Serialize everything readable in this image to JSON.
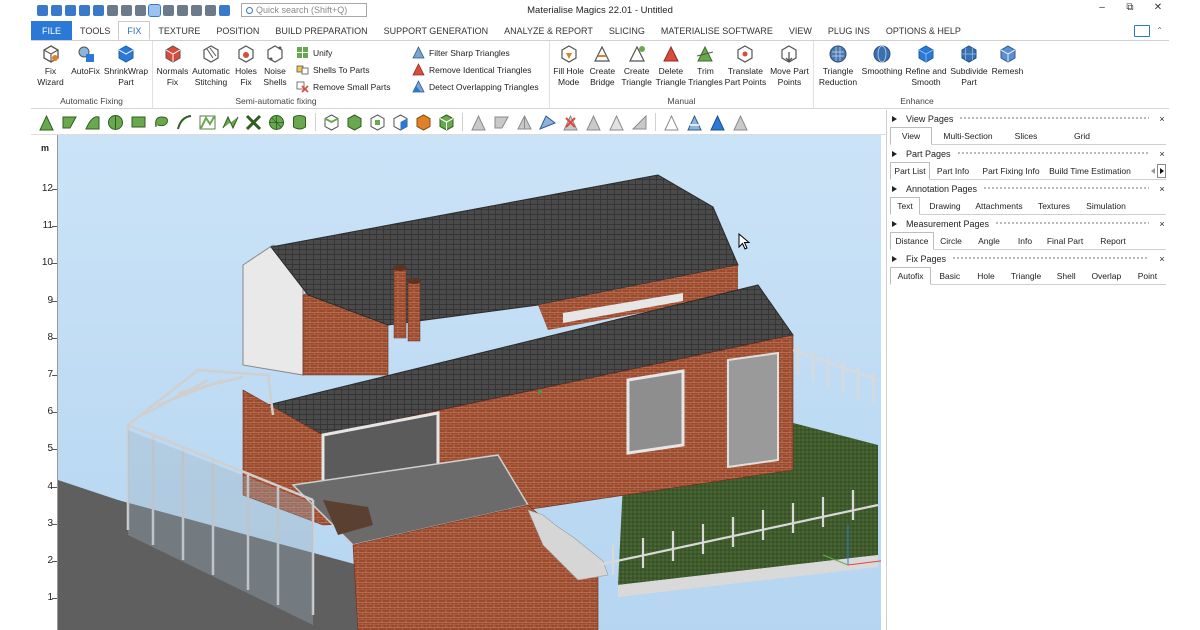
{
  "app": {
    "title": "Materialise Magics 22.01 - Untitled",
    "search_placeholder": "Quick search (Shift+Q)",
    "win_minimize": "–",
    "win_restore": "⧉",
    "win_close": "✕"
  },
  "menu": {
    "tabs": [
      "FILE",
      "TOOLS",
      "FIX",
      "TEXTURE",
      "POSITION",
      "BUILD PREPARATION",
      "SUPPORT GENERATION",
      "ANALYZE & REPORT",
      "SLICING",
      "MATERIALISE SOFTWARE",
      "VIEW",
      "PLUG INS",
      "OPTIONS & HELP"
    ],
    "active": "FIX"
  },
  "ribbon": {
    "automatic_fixing": {
      "label": "Automatic Fixing",
      "buttons": [
        "Fix Wizard",
        "AutoFix",
        "ShrinkWrap Part"
      ]
    },
    "semi_automatic_fixing": {
      "label": "Semi-automatic fixing",
      "buttons": [
        "Normals Fix",
        "Automatic Stitching",
        "Holes Fix",
        "Noise Shells"
      ],
      "small_a": [
        "Unify",
        "Shells To Parts",
        "Remove Small Parts"
      ],
      "small_b": [
        "Filter Sharp Triangles",
        "Remove Identical Triangles",
        "Detect Overlapping Triangles"
      ]
    },
    "manual": {
      "label": "Manual",
      "buttons": [
        "Fill Hole Mode",
        "Create Bridge",
        "Create Triangle",
        "Delete Triangle",
        "Trim Triangles",
        "Translate Part Points",
        "Move Part Points"
      ]
    },
    "enhance": {
      "label": "Enhance",
      "buttons": [
        "Triangle Reduction",
        "Smoothing",
        "Refine and Smooth",
        "Subdivide Part",
        "Remesh"
      ]
    }
  },
  "viewport": {
    "unit": "m",
    "ruler_ticks": [
      "12",
      "11",
      "10",
      "9",
      "8",
      "7",
      "6",
      "5",
      "4",
      "3",
      "2",
      "1"
    ]
  },
  "panel": {
    "sections": [
      {
        "title": "View Pages",
        "tabs": [
          "View",
          "Multi-Section",
          "Slices",
          "Grid"
        ],
        "active": 0
      },
      {
        "title": "Part Pages",
        "tabs": [
          "Part List",
          "Part Info",
          "Part Fixing Info",
          "Build Time Estimation"
        ],
        "active": 0
      },
      {
        "title": "Annotation Pages",
        "tabs": [
          "Text",
          "Drawing",
          "Attachments",
          "Textures",
          "Simulation"
        ],
        "active": 0
      },
      {
        "title": "Measurement Pages",
        "tabs": [
          "Distance",
          "Circle",
          "Angle",
          "Info",
          "Final Part",
          "Report"
        ],
        "active": 0
      },
      {
        "title": "Fix Pages",
        "tabs": [
          "Autofix",
          "Basic",
          "Hole",
          "Triangle",
          "Shell",
          "Overlap",
          "Point"
        ],
        "active": 0
      }
    ],
    "close_glyph": "×"
  },
  "colors": {
    "accent": "#2b79d6",
    "viewport_top": "#cbe3f7",
    "viewport_bottom": "#b5d5f1",
    "brick": "#9b4a2e",
    "roof": "#4a4a4a",
    "grass": "#3f5a2c"
  }
}
